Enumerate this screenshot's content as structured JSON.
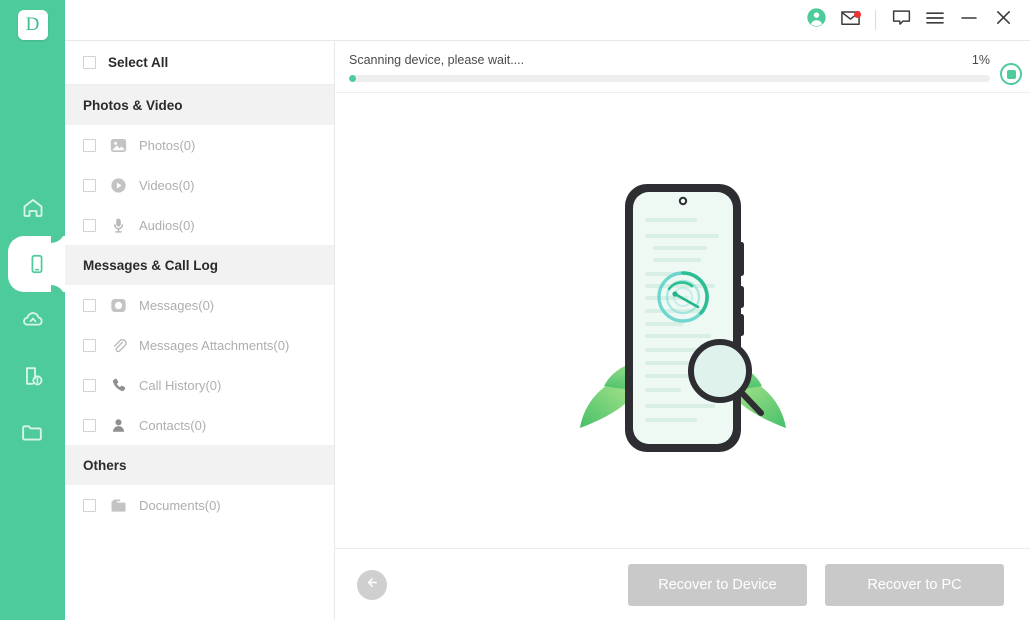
{
  "app": {
    "logo_letter": "D",
    "accent_color": "#4ecb9b",
    "badge_color": "#f03232"
  },
  "rail": {
    "items": [
      {
        "name": "home",
        "icon": "home-icon",
        "active": false
      },
      {
        "name": "device-recovery",
        "icon": "phone-icon",
        "active": true
      },
      {
        "name": "cloud-recovery",
        "icon": "cloud-icon",
        "active": false
      },
      {
        "name": "broken-device",
        "icon": "broken-device-icon",
        "active": false
      },
      {
        "name": "files",
        "icon": "folder-icon",
        "active": false
      }
    ]
  },
  "titlebar": {
    "buttons": [
      {
        "name": "account-button",
        "icon": "user-circle-icon"
      },
      {
        "name": "mail-button",
        "icon": "envelope-icon",
        "badge": true
      },
      {
        "name": "feedback-button",
        "icon": "chat-bubble-icon"
      },
      {
        "name": "menu-button",
        "icon": "hamburger-icon"
      },
      {
        "name": "minimize-button",
        "icon": "minimize-icon"
      },
      {
        "name": "close-button",
        "icon": "close-icon"
      }
    ]
  },
  "sidebar": {
    "select_all_label": "Select All",
    "groups": [
      {
        "title": "Photos & Video",
        "items": [
          {
            "label": "Photos(0)",
            "icon": "photo-icon"
          },
          {
            "label": "Videos(0)",
            "icon": "video-icon"
          },
          {
            "label": "Audios(0)",
            "icon": "microphone-icon"
          }
        ]
      },
      {
        "title": "Messages & Call Log",
        "items": [
          {
            "label": "Messages(0)",
            "icon": "message-icon"
          },
          {
            "label": "Messages Attachments(0)",
            "icon": "paperclip-icon"
          },
          {
            "label": "Call History(0)",
            "icon": "phone-call-icon"
          },
          {
            "label": "Contacts(0)",
            "icon": "contact-icon"
          }
        ]
      },
      {
        "title": "Others",
        "items": [
          {
            "label": "Documents(0)",
            "icon": "document-folder-icon"
          }
        ]
      }
    ]
  },
  "scan": {
    "message": "Scanning device, please wait....",
    "percent_label": "1%",
    "percent_value": 1,
    "stop_button_name": "stop-scan-button"
  },
  "illustration": {
    "name": "phone-scanning-illustration",
    "description": "Smartphone with document lines, radar scanning icon, magnifying glass and green leaves"
  },
  "footer": {
    "back_button": "back-button",
    "recover_to_device_label": "Recover to Device",
    "recover_to_pc_label": "Recover to PC"
  }
}
